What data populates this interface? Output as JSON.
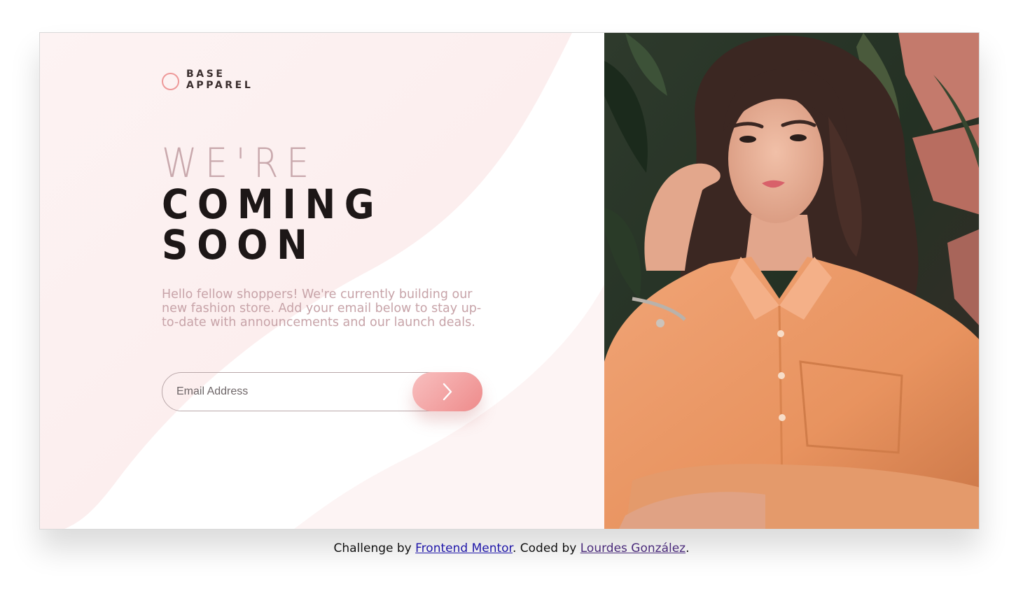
{
  "brand": {
    "line1": "BASE",
    "line2": "APPAREL"
  },
  "headline": {
    "light": "WE'RE",
    "bold1": "COMING",
    "bold2": "SOON"
  },
  "description": "Hello fellow shoppers! We're currently building our new fashion store. Add your email below to stay up-to-date with announcements and our launch deals.",
  "form": {
    "email_placeholder": "Email Address",
    "submit_icon": "arrow-right-icon"
  },
  "hero": {
    "image": "woman-in-peach-shirt-photo"
  },
  "footer": {
    "prefix": "Challenge by ",
    "link1": "Frontend Mentor",
    "middle": ". Coded by ",
    "link2": "Lourdes González",
    "suffix": "."
  },
  "colors": {
    "accent": "#ee8b8b",
    "accent_light": "#f8bfbf",
    "heading_light": "#c9a9ad",
    "text_muted": "#c7a3a8",
    "heading_dark": "#1d1717"
  }
}
